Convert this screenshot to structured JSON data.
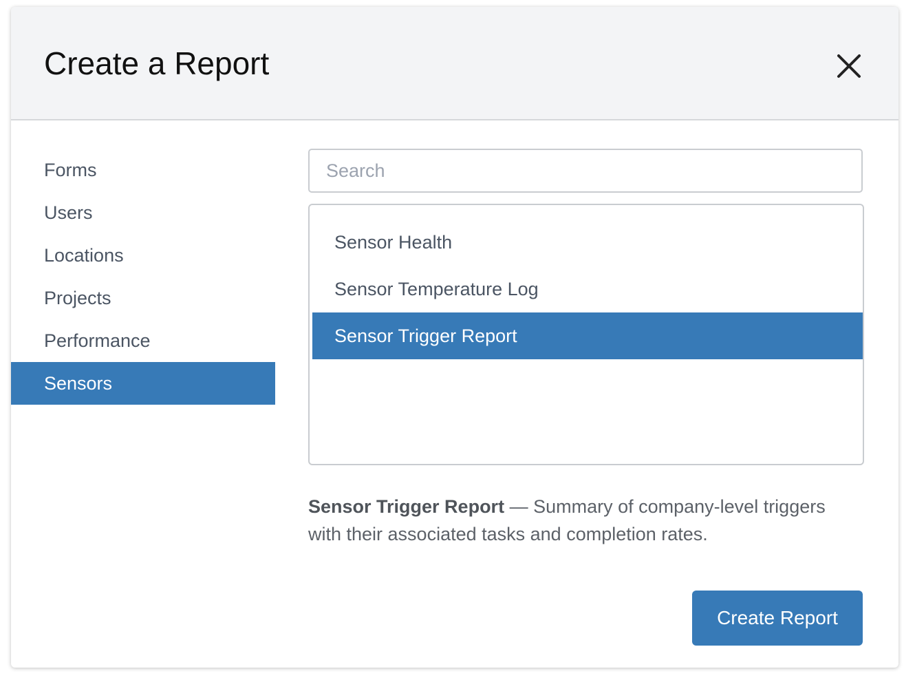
{
  "dialog": {
    "title": "Create a Report",
    "close_icon": "close-icon"
  },
  "categories": [
    {
      "label": "Forms",
      "active": false
    },
    {
      "label": "Users",
      "active": false
    },
    {
      "label": "Locations",
      "active": false
    },
    {
      "label": "Projects",
      "active": false
    },
    {
      "label": "Performance",
      "active": false
    },
    {
      "label": "Sensors",
      "active": true
    }
  ],
  "search": {
    "placeholder": "Search",
    "value": ""
  },
  "reports": [
    {
      "label": "Sensor Health",
      "selected": false
    },
    {
      "label": "Sensor Temperature Log",
      "selected": false
    },
    {
      "label": "Sensor Trigger Report",
      "selected": true
    }
  ],
  "description": {
    "name": "Sensor Trigger Report",
    "separator": " — ",
    "text": "Summary of company-level triggers with their associated tasks and completion rates."
  },
  "actions": {
    "create_label": "Create Report"
  },
  "colors": {
    "accent": "#377ab7",
    "header_bg": "#f3f4f6"
  }
}
